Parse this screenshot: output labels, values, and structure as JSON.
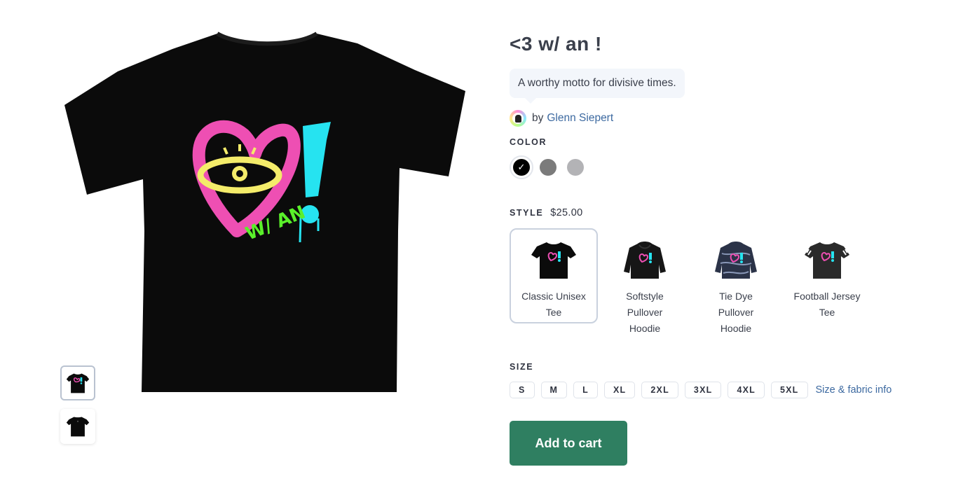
{
  "product": {
    "title": "<3 w/ an !",
    "motto": "A worthy motto for divisive times.",
    "by_text": "by",
    "author": "Glenn Siepert",
    "artwork_text": "W/ AN"
  },
  "color": {
    "label": "COLOR",
    "options": [
      {
        "name": "black",
        "hex": "#000000",
        "selected": true
      },
      {
        "name": "charcoal",
        "hex": "#7b7b7b",
        "selected": false
      },
      {
        "name": "grey",
        "hex": "#b3b3b6",
        "selected": false
      }
    ]
  },
  "style": {
    "label": "STYLE",
    "price": "$25.00",
    "options": [
      {
        "line1": "Classic Unisex",
        "line2": "Tee",
        "line3": "",
        "icon": "tshirt-icon",
        "selected": true
      },
      {
        "line1": "Softstyle",
        "line2": "Pullover",
        "line3": "Hoodie",
        "icon": "hoodie-icon",
        "selected": false
      },
      {
        "line1": "Tie Dye",
        "line2": "Pullover",
        "line3": "Hoodie",
        "icon": "tie-dye-hoodie-icon",
        "selected": false
      },
      {
        "line1": "Football Jersey",
        "line2": "Tee",
        "line3": "",
        "icon": "jersey-icon",
        "selected": false
      }
    ]
  },
  "size": {
    "label": "SIZE",
    "options": [
      "S",
      "M",
      "L",
      "XL",
      "2XL",
      "3XL",
      "4XL",
      "5XL"
    ],
    "info_link": "Size & fabric info"
  },
  "cart": {
    "button_label": "Add to cart"
  },
  "colors": {
    "accent_green": "#2f7f61",
    "link_blue": "#3c69a0",
    "heart_pink": "#ee4fb3",
    "exclaim_cyan": "#26e3f0",
    "eye_yellow": "#f4ec6a",
    "text_green": "#5af02a"
  }
}
